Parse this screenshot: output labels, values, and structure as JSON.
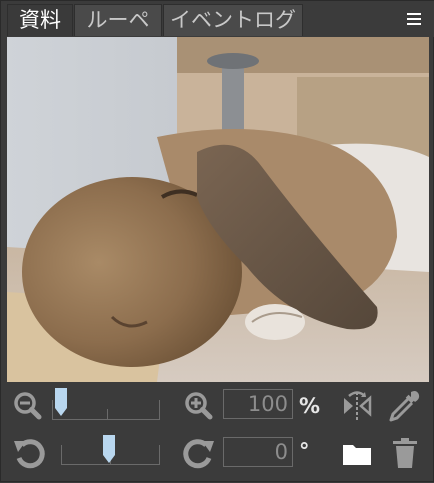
{
  "tabs": [
    {
      "label": "資料",
      "active": true
    },
    {
      "label": "ルーペ",
      "active": false
    },
    {
      "label": "イベントログ",
      "active": false
    }
  ],
  "menu_icon": "hamburger-menu-icon",
  "image": {
    "subject": "sleeping lop-eared rabbit photo"
  },
  "zoom": {
    "value": "100",
    "unit": "%",
    "slider_level_fraction": 0.07,
    "zoom_out_icon": "zoom-out-icon",
    "zoom_in_icon": "zoom-in-icon"
  },
  "rotation": {
    "value": "0",
    "unit": "°",
    "slider_level_fraction": 0.5,
    "rotate_left_icon": "rotate-ccw-icon",
    "rotate_right_icon": "rotate-cw-icon"
  },
  "tools": {
    "flip_icon": "flip-horizontal-icon",
    "eyedropper_icon": "eyedropper-icon",
    "folder_icon": "folder-icon",
    "trash_icon": "trash-icon"
  },
  "colors": {
    "background": "#3b3b3b",
    "icon_gray": "#9a9a9a",
    "thumb_blue": "#b9d7ef",
    "text_muted": "#8d8d8d"
  }
}
